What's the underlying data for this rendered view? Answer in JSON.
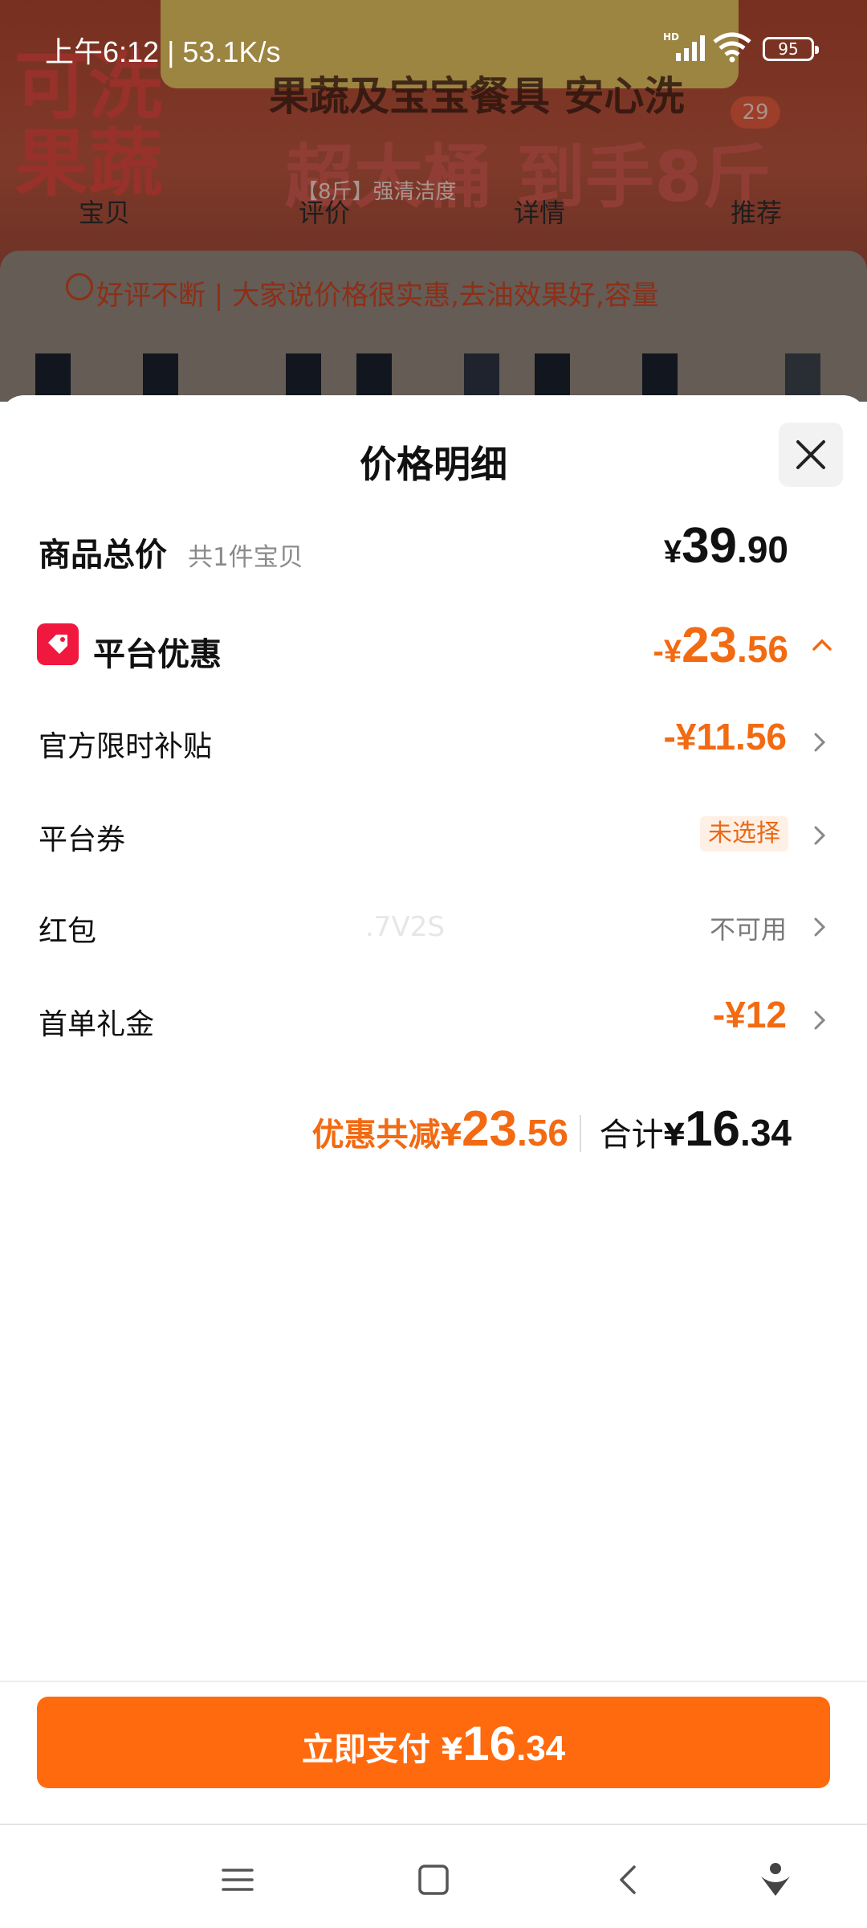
{
  "status_bar": {
    "time": "上午6:12 | 53.1K/s",
    "battery": "95",
    "icons": [
      "hd-signal-icon",
      "wifi-icon",
      "battery-icon"
    ]
  },
  "background": {
    "left_text": "可洗\n果蔬",
    "headline": "果蔬及宝宝餐具 安心洗",
    "headline_big": "超大桶 到手8斤",
    "sub": "【8斤】强清洁度",
    "badge": "29",
    "tabs": [
      "宝贝",
      "评价",
      "详情",
      "推荐"
    ],
    "review": "好评不断 | 大家说价格很实惠,去油效果好,容量"
  },
  "sheet": {
    "title": "价格明细",
    "close_icon": "close-icon",
    "total": {
      "label": "商品总价",
      "sub": "共1件宝贝",
      "currency": "¥",
      "int": "39",
      "dec": ".90"
    },
    "platform": {
      "label": "平台优惠",
      "sign": "-",
      "currency": "¥",
      "int": "23",
      "dec": ".56",
      "icon": "tag-icon",
      "expand_icon": "chevron-up-icon"
    },
    "subsidy": {
      "label": "官方限时补贴",
      "value": "-¥11.56"
    },
    "coupon": {
      "label": "平台券",
      "value": "未选择"
    },
    "redpacket": {
      "label": "红包",
      "value": "不可用",
      "watermark": ".7V2S"
    },
    "first_order": {
      "label": "首单礼金",
      "value": "-¥12"
    },
    "summary": {
      "discount_label": "优惠共减",
      "discount_currency": "¥",
      "discount_int": "23",
      "discount_dec": ".56",
      "total_label": "合计",
      "total_currency": "¥",
      "total_int": "16",
      "total_dec": ".34"
    },
    "pay": {
      "label": "立即支付 ",
      "currency": "¥",
      "int": "16",
      "dec": ".34"
    }
  },
  "nav_bar": {
    "icons": [
      "menu-icon",
      "home-icon",
      "back-icon",
      "assistant-icon"
    ]
  },
  "colors": {
    "accent": "#ff6a0e",
    "discount": "#f26a12",
    "tag": "#f0183e"
  }
}
